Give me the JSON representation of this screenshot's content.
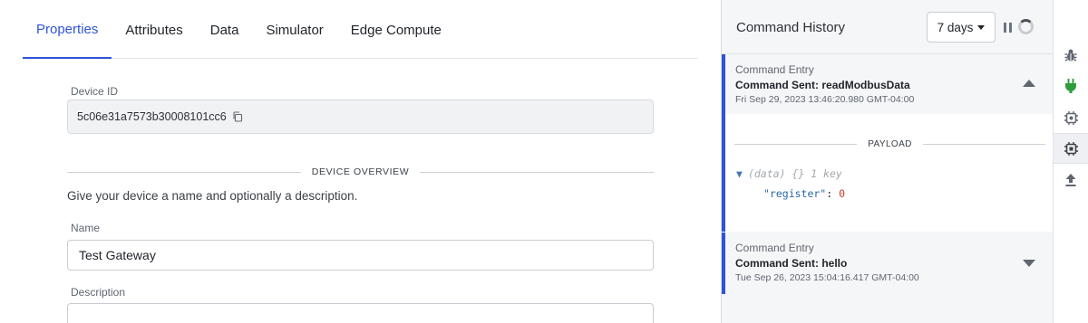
{
  "tabs": [
    {
      "label": "Properties",
      "active": true
    },
    {
      "label": "Attributes",
      "active": false
    },
    {
      "label": "Data",
      "active": false
    },
    {
      "label": "Simulator",
      "active": false
    },
    {
      "label": "Edge Compute",
      "active": false
    }
  ],
  "device_id": {
    "label": "Device ID",
    "value": "5c06e31a7573b30008101cc6",
    "copy_icon": "copy-icon"
  },
  "overview": {
    "section_title": "DEVICE OVERVIEW",
    "description": "Give your device a name and optionally a description."
  },
  "name_field": {
    "label": "Name",
    "value": "Test Gateway"
  },
  "description_field": {
    "label": "Description",
    "value": ""
  },
  "history": {
    "title": "Command History",
    "range": "7 days",
    "entries": [
      {
        "kind": "Command Entry",
        "sent_prefix": "Command Sent: ",
        "command": "readModbusData",
        "timestamp": "Fri Sep 29, 2023 13:46:20.980 GMT-04:00",
        "expanded": true,
        "payload_title": "PAYLOAD",
        "payload_root": "(data)",
        "payload_summary": "{} 1 key",
        "payload_key": "\"register\"",
        "payload_value": "0"
      },
      {
        "kind": "Command Entry",
        "sent_prefix": "Command Sent: ",
        "command": "hello",
        "timestamp": "Tue Sep 26, 2023 15:04:16.417 GMT-04:00",
        "expanded": false
      }
    ]
  },
  "rail": {
    "icons": [
      "bug-icon",
      "plug-icon",
      "chip-settings-icon",
      "chip-icon",
      "upload-icon"
    ],
    "active_index": 3,
    "accent": "#2f54d6",
    "plug_color": "#2e9d3b"
  }
}
